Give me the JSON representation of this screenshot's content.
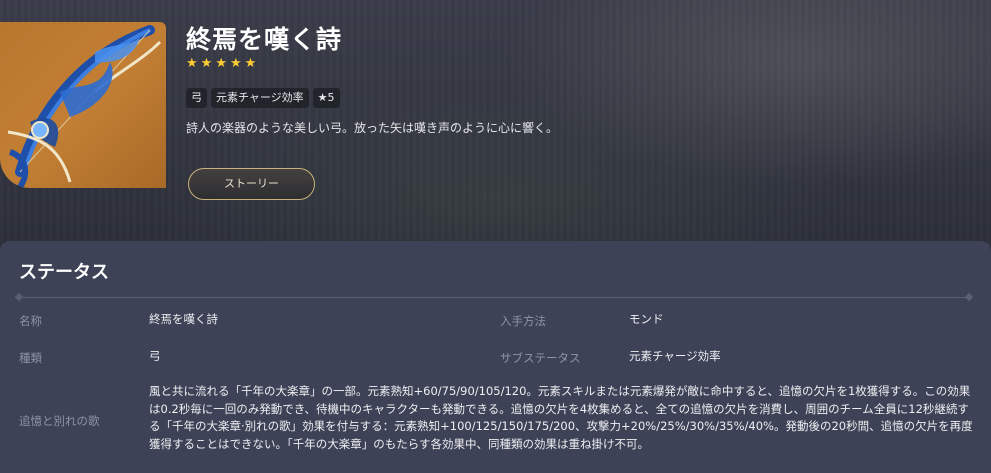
{
  "weapon": {
    "name": "終焉を嘆く詩",
    "rarity": 5,
    "stars": [
      "★",
      "★",
      "★",
      "★",
      "★"
    ],
    "tags": [
      "弓",
      "元素チャージ効率",
      "★5"
    ],
    "description": "詩人の楽器のような美しい弓。放った矢は嘆き声のように心に響く。",
    "story_button": "ストーリー",
    "card_color": "#b8762e",
    "icon": "bow-icon"
  },
  "status": {
    "heading": "ステータス",
    "rows": {
      "name_label": "名称",
      "name_value": "終焉を嘆く詩",
      "obtain_label": "入手方法",
      "obtain_value": "モンド",
      "type_label": "種類",
      "type_value": "弓",
      "substat_label": "サブステータス",
      "substat_value": "元素チャージ効率",
      "effect_label": "追憶と別れの歌",
      "effect_value": "風と共に流れる「千年の大楽章」の一部。元素熟知+60/75/90/105/120。元素スキルまたは元素爆発が敵に命中すると、追憶の欠片を1枚獲得する。この効果は0.2秒毎に一回のみ発動でき、待機中のキャラクターも発動できる。追憶の欠片を4枚集めると、全ての追憶の欠片を消費し、周囲のチーム全員に12秒継続する「千年の大楽章·別れの歌」効果を付与する：元素熟知+100/125/150/175/200、攻撃力+20%/25%/30%/35%/40%。発動後の20秒間、追憶の欠片を再度獲得することはできない。「千年の大楽章」のもたらす各効果中、同種類の効果は重ね掛け不可。"
    }
  }
}
